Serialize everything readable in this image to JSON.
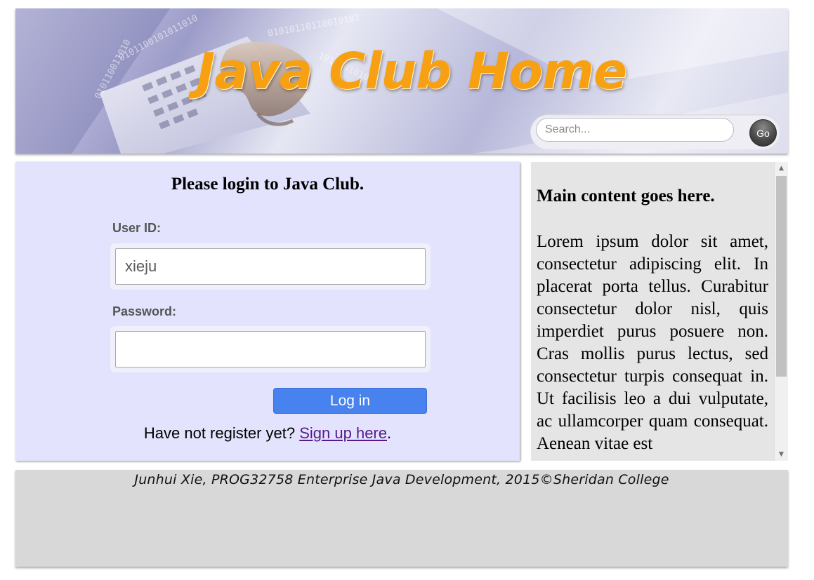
{
  "header": {
    "title": "Java Club Home",
    "search": {
      "placeholder": "Search...",
      "value": ""
    },
    "go_label": "Go",
    "banner_image": "laptop-typing-binary-banner",
    "title_color": "#f7a012"
  },
  "login": {
    "heading": "Please login to Java Club.",
    "userid_label": "User ID:",
    "userid_value": "xieju",
    "password_label": "Password:",
    "password_value": "",
    "button_label": "Log in",
    "register_prefix": "Have not register yet?",
    "register_link": "Sign up here",
    "register_suffix": ".",
    "panel_color": "#e3e3fd",
    "button_color": "#4782ee"
  },
  "content": {
    "heading": "Main content goes here.",
    "body": "Lorem ipsum dolor sit amet, consectetur adipiscing elit. In placerat porta tellus. Curabitur consectetur dolor nisl, quis imperdiet purus posuere non. Cras mollis purus lectus, sed consectetur turpis consequat in. Ut facilisis leo a dui vulputate, ac ullamcorper quam consequat. Aenean vitae est"
  },
  "footer": {
    "text": "Junhui Xie, PROG32758 Enterprise Java Development, 2015©Sheridan College"
  }
}
